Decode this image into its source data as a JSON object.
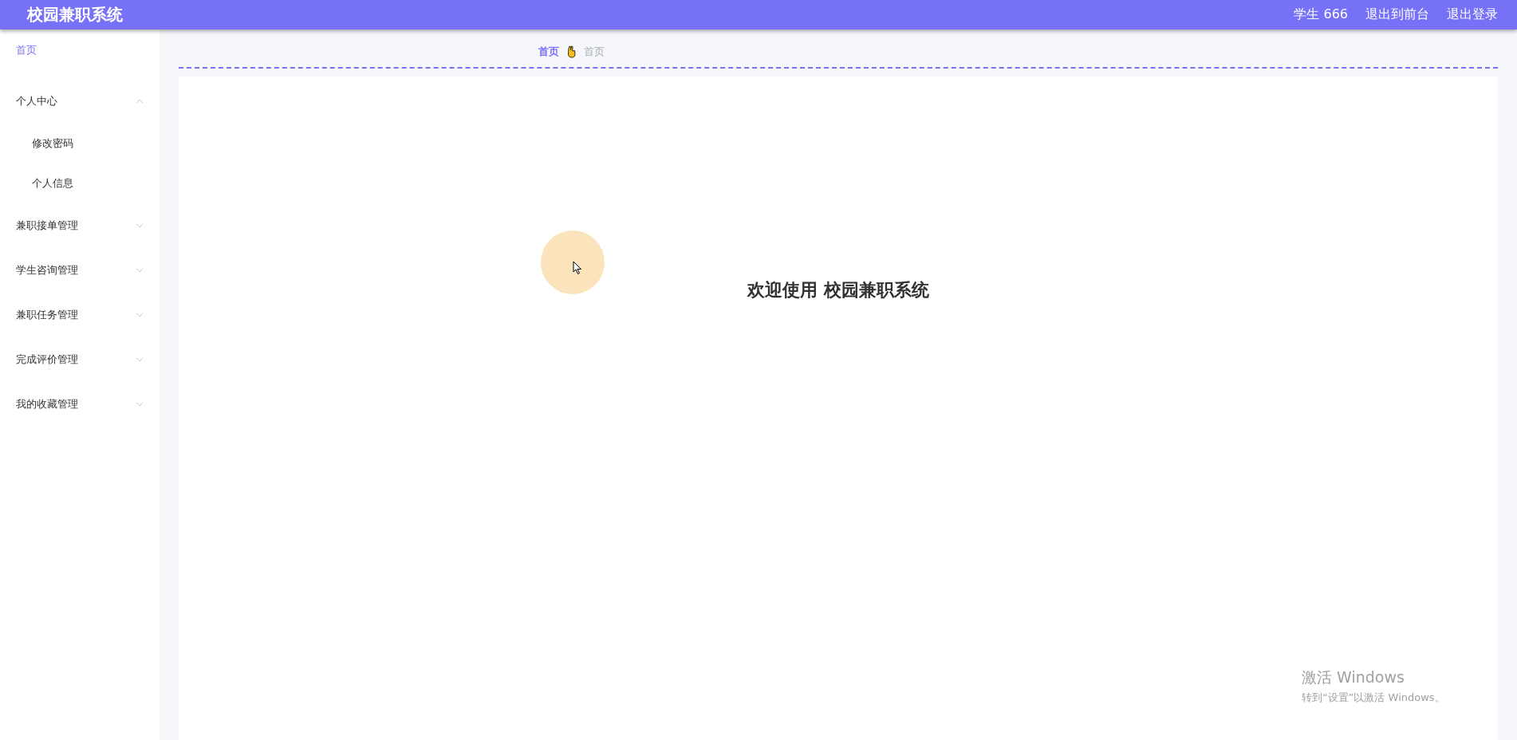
{
  "header": {
    "title": "校园兼职系统",
    "user": "学生 666",
    "links": [
      "退出到前台",
      "退出登录"
    ]
  },
  "sidebar": {
    "items": [
      {
        "kind": "link",
        "label": "首页",
        "selected": true
      },
      {
        "kind": "submenu",
        "label": "个人中心",
        "expanded": true,
        "children": [
          {
            "label": "修改密码",
            "selected": false
          },
          {
            "label": "个人信息",
            "selected": false
          }
        ]
      },
      {
        "kind": "submenu",
        "label": "兼职接单管理",
        "expanded": false
      },
      {
        "kind": "submenu",
        "label": "学生咨询管理",
        "expanded": false
      },
      {
        "kind": "submenu",
        "label": "兼职任务管理",
        "expanded": false
      },
      {
        "kind": "submenu",
        "label": "完成评价管理",
        "expanded": false
      },
      {
        "kind": "submenu",
        "label": "我的收藏管理",
        "expanded": false
      }
    ]
  },
  "breadcrumb": [
    {
      "label": "首页",
      "current": false
    },
    {
      "label": "首页",
      "current": true
    }
  ],
  "welcome": "欢迎使用 校园兼职系统",
  "os_notice": {
    "title": "激活 Windows",
    "message": "转到“设置”以激活 Windows。"
  }
}
